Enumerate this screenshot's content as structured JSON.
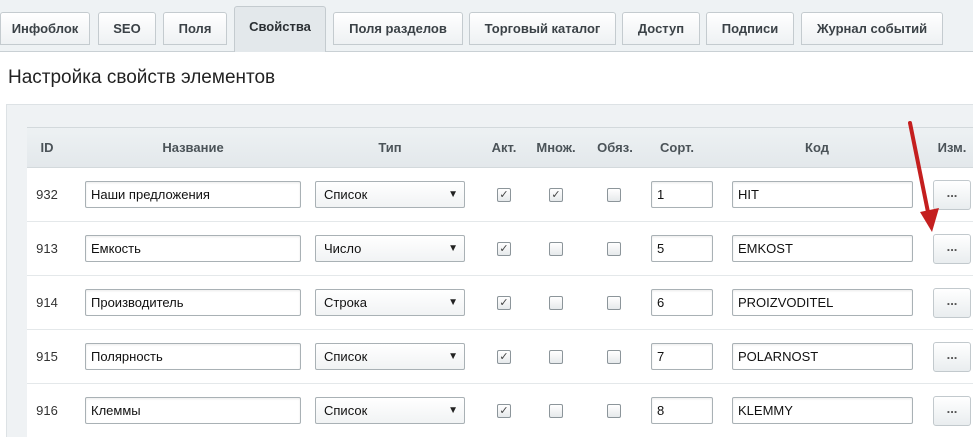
{
  "tabs": [
    {
      "label": "Инфоблок",
      "active": false
    },
    {
      "label": "SEO",
      "active": false
    },
    {
      "label": "Поля",
      "active": false
    },
    {
      "label": "Свойства",
      "active": true
    },
    {
      "label": "Поля разделов",
      "active": false
    },
    {
      "label": "Торговый каталог",
      "active": false
    },
    {
      "label": "Доступ",
      "active": false
    },
    {
      "label": "Подписи",
      "active": false
    },
    {
      "label": "Журнал событий",
      "active": false
    }
  ],
  "page_title": "Настройка свойств элементов",
  "table": {
    "columns": {
      "id": "ID",
      "name": "Название",
      "type": "Тип",
      "active": "Акт.",
      "multiple": "Множ.",
      "required": "Обяз.",
      "sort": "Сорт.",
      "code": "Код",
      "edit": "Изм."
    },
    "rows": [
      {
        "id": "932",
        "name": "Наши предложения",
        "type": "Список",
        "active": true,
        "multiple": true,
        "required": false,
        "sort": "1",
        "code": "HIT",
        "edit": "..."
      },
      {
        "id": "913",
        "name": "Емкость",
        "type": "Число",
        "active": true,
        "multiple": false,
        "required": false,
        "sort": "5",
        "code": "EMKOST",
        "edit": "..."
      },
      {
        "id": "914",
        "name": "Производитель",
        "type": "Строка",
        "active": true,
        "multiple": false,
        "required": false,
        "sort": "6",
        "code": "PROIZVODITEL",
        "edit": "..."
      },
      {
        "id": "915",
        "name": "Полярность",
        "type": "Список",
        "active": true,
        "multiple": false,
        "required": false,
        "sort": "7",
        "code": "POLARNOST",
        "edit": "..."
      },
      {
        "id": "916",
        "name": "Клеммы",
        "type": "Список",
        "active": true,
        "multiple": false,
        "required": false,
        "sort": "8",
        "code": "KLEMMY",
        "edit": "..."
      }
    ]
  },
  "colors": {
    "annotation_arrow": "#c41f1f",
    "tabbar_bg": "#eef2f4",
    "panel_bg": "#eff2f4"
  },
  "icons": {
    "checkbox_checked": "check-icon",
    "select_arrow": "caret-down-icon"
  }
}
